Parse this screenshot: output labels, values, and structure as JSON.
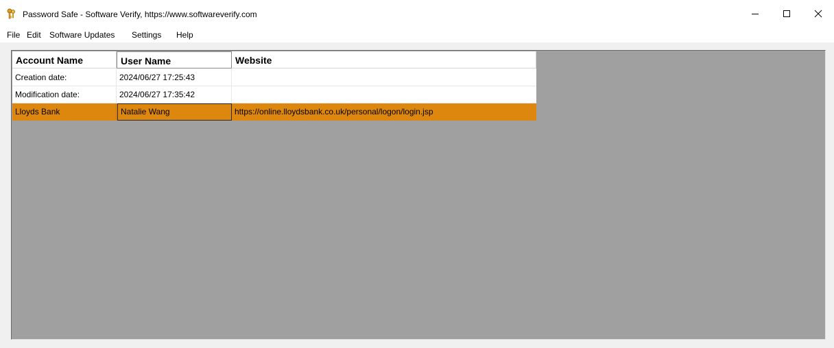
{
  "window": {
    "title": "Password Safe - Software Verify, https://www.softwareverify.com",
    "icon": "keys-icon",
    "controls": {
      "minimize": "minimize-icon",
      "maximize": "maximize-icon",
      "close": "close-icon"
    }
  },
  "menu": [
    "File",
    "Edit",
    "Software Updates",
    "Settings",
    "Help"
  ],
  "table": {
    "columns": [
      "Account Name",
      "User Name",
      "Website"
    ],
    "rows": [
      {
        "account": "Creation date:",
        "user": "2024/06/27 17:25:43",
        "website": "",
        "selected": false
      },
      {
        "account": "Modification date:",
        "user": "2024/06/27 17:35:42",
        "website": "",
        "selected": false
      },
      {
        "account": "Lloyds Bank",
        "user": "Natalie Wang",
        "website": "https://online.lloydsbank.co.uk/personal/logon/login.jsp",
        "selected": true
      }
    ]
  },
  "colors": {
    "selection": "#dd870e",
    "workspace": "#a0a0a0",
    "icon_gold": "#e0a020"
  }
}
